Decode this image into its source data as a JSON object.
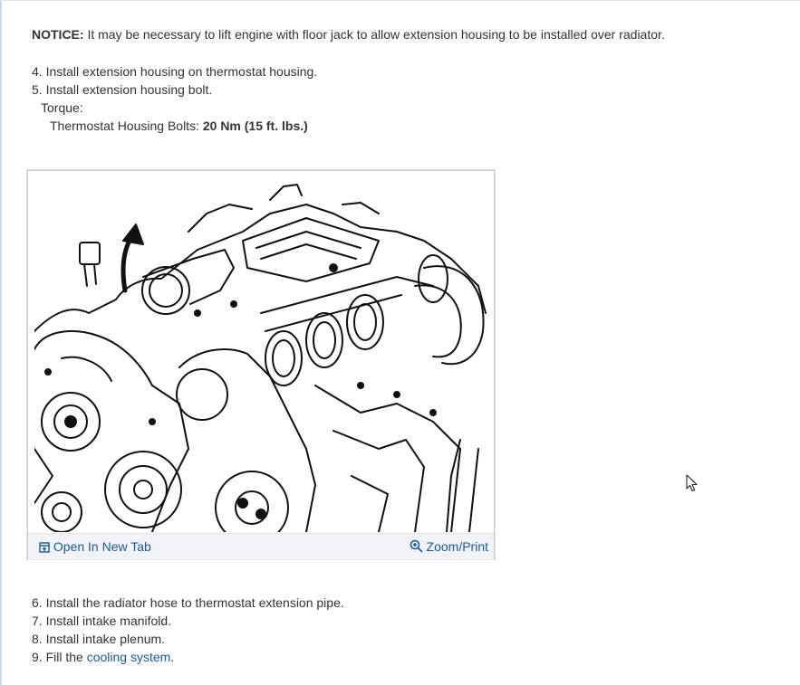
{
  "notice": {
    "label": "NOTICE:",
    "text": " It may be necessary to lift engine with floor jack to allow extension housing to be installed over radiator."
  },
  "steps_before": [
    "4. Install extension housing on thermostat housing.",
    "5. Install extension housing bolt."
  ],
  "torque": {
    "label": "Torque:",
    "item_label": "Thermostat Housing Bolts: ",
    "item_value": "20 Nm (15 ft. lbs.)"
  },
  "figure": {
    "open_label": "Open In New Tab",
    "zoom_label": "Zoom/Print",
    "open_icon": "open-in-new-tab-icon",
    "zoom_icon": "magnifier-plus-icon"
  },
  "steps_after": [
    "6. Install the radiator hose to thermostat extension pipe.",
    "7. Install intake manifold.",
    "8. Install intake plenum."
  ],
  "step9": {
    "prefix": "9. Fill the ",
    "link": "cooling system",
    "suffix": "."
  },
  "colors": {
    "text": "#333333",
    "link": "#1a5a9c",
    "figure_bar": "#f1f3f6"
  }
}
